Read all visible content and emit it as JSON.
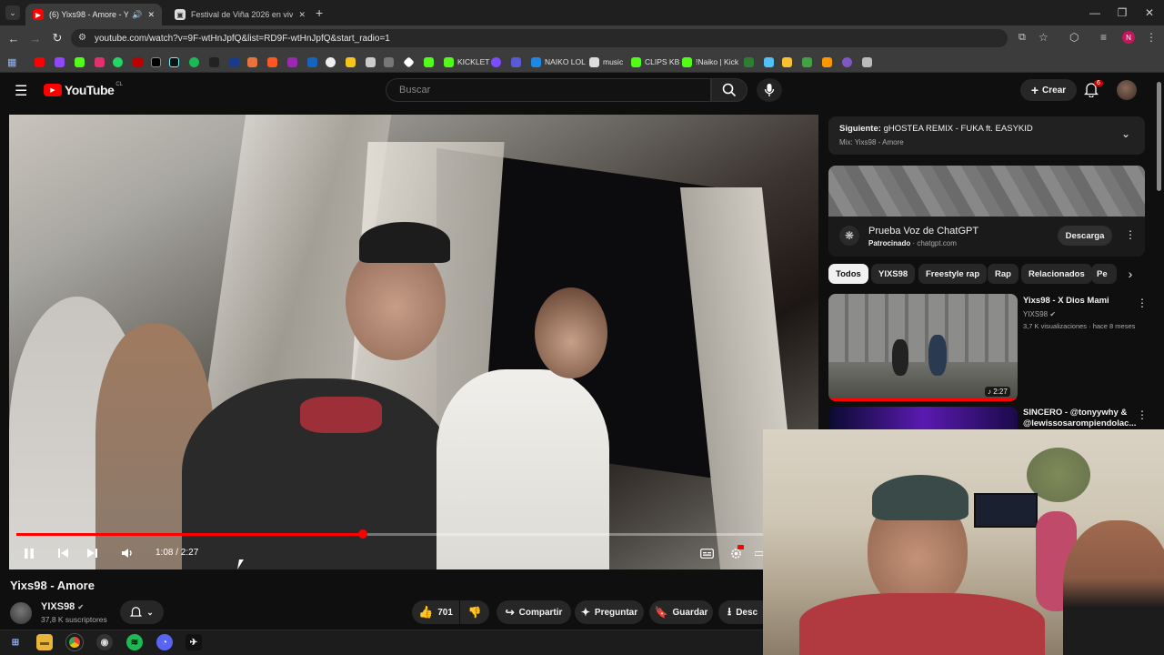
{
  "browser": {
    "tabs": [
      {
        "label": "(6) Yixs98 - Amore - YouTube",
        "active": true
      },
      {
        "label": "Festival de Viña 2026 en vivo -",
        "active": false
      }
    ],
    "url": "youtube.com/watch?v=9F-wtHnJpfQ&list=RD9F-wtHnJpfQ&start_radio=1",
    "profile_initial": "N",
    "bookmarks": [
      "KICKLET",
      "NAIKO LOL",
      "music",
      "CLIPS KB",
      "!Naiko | Kick"
    ]
  },
  "youtube": {
    "logo": "YouTube",
    "region": "CL",
    "search_placeholder": "Buscar",
    "create_label": "Crear",
    "notification_count": "6"
  },
  "player": {
    "time": "1:08 / 2:27",
    "progress_fraction": 0.463
  },
  "video": {
    "title": "Yixs98 - Amore",
    "channel": "YIXS98",
    "subscribers": "37,8 K suscriptores",
    "actions": {
      "likes": "701",
      "share": "Compartir",
      "ask": "Preguntar",
      "save": "Guardar",
      "download": "Desc"
    }
  },
  "sidebar": {
    "next_prefix": "Siguiente:",
    "next_title": "gHOSTEA REMIX - FUKA ft. EASYKID",
    "next_mix": "Mix: Yixs98 - Amore",
    "ad": {
      "title": "Prueba Voz de ChatGPT",
      "sponsored": "Patrocinado",
      "domain": "chatgpt.com",
      "cta": "Descarga"
    },
    "chips": [
      "Todos",
      "YIXS98",
      "Freestyle rap",
      "Rap",
      "Relacionados",
      "Pe"
    ],
    "videos": [
      {
        "title": "Yixs98 - X Dios Mami",
        "channel": "YIXS98",
        "meta": "3,7 K visualizaciones · hace 8 meses",
        "duration": "2:27"
      },
      {
        "title": "SINCERO - @tonyywhy & @lewissosarompiendolac...",
        "channel": "",
        "meta": "",
        "duration": ""
      }
    ]
  },
  "colors": {
    "accent_red": "#ff0000",
    "background": "#0f0f0f"
  }
}
